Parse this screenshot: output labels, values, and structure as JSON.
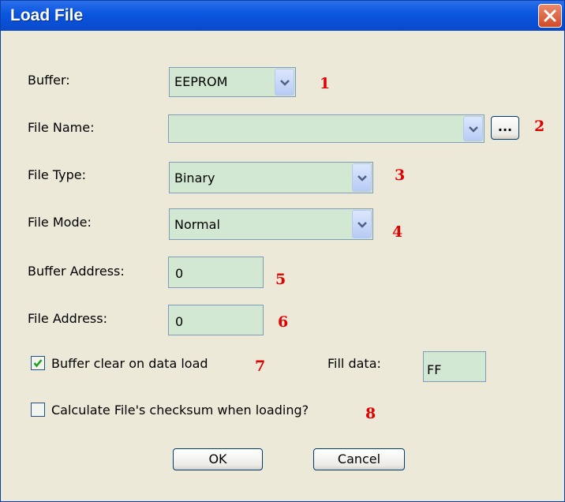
{
  "window": {
    "title": "Load File"
  },
  "form": {
    "buffer": {
      "label": "Buffer:",
      "value": "EEPROM"
    },
    "file_name": {
      "label": "File Name:",
      "value": "",
      "browse_label": "..."
    },
    "file_type": {
      "label": "File Type:",
      "value": "Binary"
    },
    "file_mode": {
      "label": "File Mode:",
      "value": "Normal"
    },
    "buffer_address": {
      "label": "Buffer Address:",
      "value": "0"
    },
    "file_address": {
      "label": "File Address:",
      "value": "0"
    },
    "buffer_clear": {
      "label": "Buffer clear on data load",
      "checked": true
    },
    "fill_data": {
      "label": "Fill data:",
      "value": "FF"
    },
    "checksum": {
      "label": "Calculate File's checksum when loading?",
      "checked": false
    }
  },
  "annotations": [
    "1",
    "2",
    "3",
    "4",
    "5",
    "6",
    "7",
    "8"
  ],
  "buttons": {
    "ok": "OK",
    "cancel": "Cancel"
  },
  "icons": {
    "close": "close-icon",
    "dropdown": "chevron-down-icon",
    "check": "check-icon"
  },
  "colors": {
    "field_background": "#d3e8d3",
    "annotation": "#e20000",
    "titlebar": "#0a56e0"
  }
}
